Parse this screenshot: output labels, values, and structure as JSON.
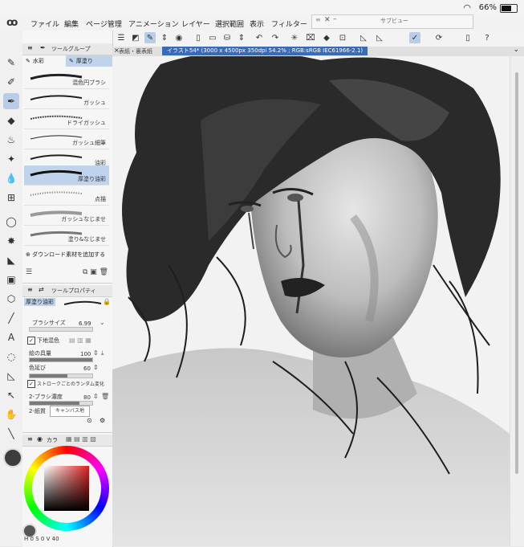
{
  "status": {
    "battery": "66%"
  },
  "menubar": {
    "items": [
      "ファイル",
      "編集",
      "ページ管理",
      "アニメーション",
      "レイヤー",
      "選択範囲",
      "表示",
      "フィルター"
    ]
  },
  "subview": {
    "title": "サブビュー"
  },
  "tabs": [
    {
      "label": "表紙・裏表紙"
    },
    {
      "label": "イラスト54* (3000 x 4500px 350dpi 54.2% ; RGB:sRGB IEC61966-2.1)"
    }
  ],
  "sub_tool": {
    "title": "ツールグループ",
    "groups": [
      "水彩",
      "厚塗り"
    ],
    "brushes": [
      "混色円ブラシ",
      "ガッシュ",
      "ドライガッシュ",
      "ガッシュ細筆",
      "油彩",
      "厚塗り油彩",
      "点描",
      "ガッシュなじませ",
      "塗り&なじませ"
    ],
    "selected_brush": "厚塗り油彩",
    "download_label": "ダウンロード素材を追加する"
  },
  "tool_property": {
    "title": "ツールプロパティ",
    "brush_name": "厚塗り油彩",
    "brush_size_label": "ブラシサイズ",
    "brush_size_value": "6.99",
    "underlay_label": "下地混色",
    "paint_amount_label": "絵の具量",
    "paint_amount_value": "100",
    "paint_amount_level": 1.0,
    "color_stretch_label": "色延び",
    "color_stretch_value": "60",
    "color_stretch_level": 0.6,
    "random_label": "ストロークごとのランダム変化",
    "density_label": "2-ブラシ濃度",
    "density_value": "80",
    "density_level": 0.8,
    "paper_label": "2-紙質",
    "paper_button": "キャンバス地"
  },
  "color_panel": {
    "tab_label": "カラ",
    "main_color": "#3c3c3c",
    "values": [
      "H",
      "0",
      "S",
      "0",
      "V",
      "40"
    ]
  },
  "colors": {
    "accent": "#3a6bb8",
    "selected": "#b9cde6"
  }
}
